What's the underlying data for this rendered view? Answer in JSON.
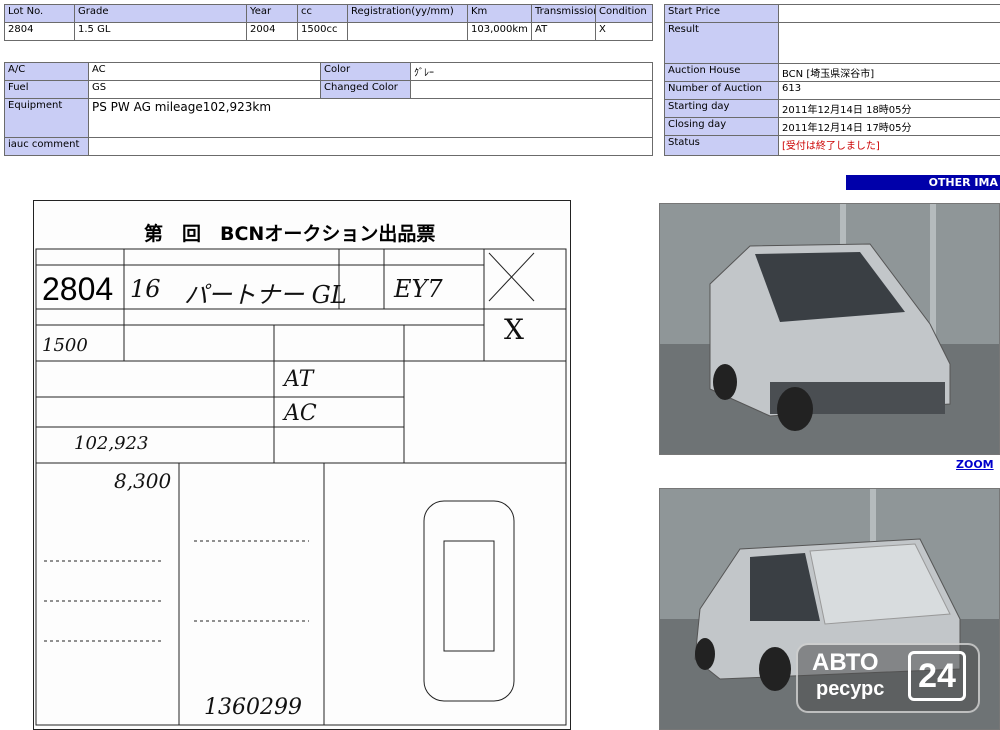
{
  "lot_table": {
    "headers": [
      "Lot No.",
      "Grade",
      "Year",
      "cc",
      "Registration(yy/mm)",
      "Km",
      "Transmission",
      "Condition"
    ],
    "values": [
      "2804",
      "1.5 GL",
      "2004",
      "1500cc",
      "",
      "103,000km",
      "AT",
      "X"
    ]
  },
  "spec_table": {
    "ac_label": "A/C",
    "ac_value": "AC",
    "color_label": "Color",
    "color_value": "ｸﾞﾚｰ",
    "fuel_label": "Fuel",
    "fuel_value": "GS",
    "changed_color_label": "Changed Color",
    "changed_color_value": "",
    "equipment_label": "Equipment",
    "equipment_value": "PS PW AG  mileage102,923km",
    "comment_label": "iauc comment",
    "comment_value": ""
  },
  "auction_table": {
    "start_price_label": "Start Price",
    "start_price_value": "",
    "result_label": "Result",
    "result_value": "",
    "house_label": "Auction House",
    "house_value": "BCN [埼玉県深谷市]",
    "num_label": "Number of Auction",
    "num_value": "613",
    "start_day_label": "Starting day",
    "start_day_value": "2011年12月14日 18時05分",
    "close_day_label": "Closing day",
    "close_day_value": "2011年12月14日 17時05分",
    "status_label": "Status",
    "status_value": "[受付は終了しました]"
  },
  "other_images_label": "OTHER IMA",
  "zoom_label": "ZOOM",
  "sheet": {
    "title": "第　回　BCNオークション出品票",
    "lot": "2804",
    "year": "16",
    "model": "パートナー GL",
    "grade": "EY7",
    "score": "X",
    "cc": "1500",
    "shift": "AT",
    "ac": "AC",
    "mileage": "102,923",
    "recycle": "8,300",
    "reg_no": "1360299"
  },
  "watermark": {
    "line1": "АВТО",
    "line2": "ресурс",
    "num": "24"
  },
  "colors": {
    "header_bg": "#c9cdf5",
    "status_red": "#cc0000",
    "bar_blue": "#0000aa",
    "link": "#0000cc"
  }
}
